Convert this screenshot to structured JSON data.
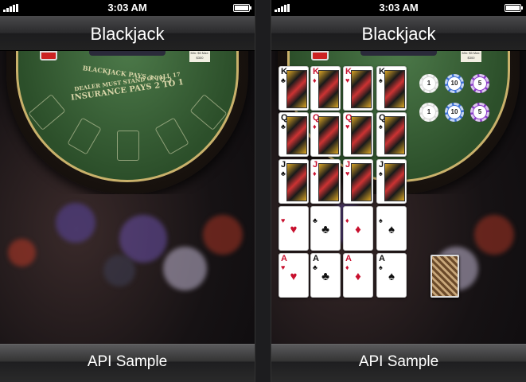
{
  "status": {
    "time": "3:03 AM"
  },
  "screens": [
    {
      "title": "Blackjack",
      "footer": "API Sample"
    },
    {
      "title": "Blackjack",
      "footer": "API Sample"
    }
  ],
  "table": {
    "line1": "BLACKJACK PAYS 3 TO 2",
    "line2": "DEALER MUST STAND ON ALL 17",
    "line3": "INSURANCE PAYS 2 TO 1",
    "minmax": "Min: $5 Max: $300"
  },
  "cards": {
    "row1": [
      {
        "rank": "K",
        "suit": "♣",
        "color": "black"
      },
      {
        "rank": "K",
        "suit": "♦",
        "color": "red"
      },
      {
        "rank": "K",
        "suit": "♥",
        "color": "red"
      },
      {
        "rank": "K",
        "suit": "♠",
        "color": "black"
      }
    ],
    "row2": [
      {
        "rank": "Q",
        "suit": "♣",
        "color": "black"
      },
      {
        "rank": "Q",
        "suit": "♦",
        "color": "red"
      },
      {
        "rank": "Q",
        "suit": "♥",
        "color": "red"
      },
      {
        "rank": "Q",
        "suit": "♠",
        "color": "black"
      }
    ],
    "row3": [
      {
        "rank": "J",
        "suit": "♣",
        "color": "black"
      },
      {
        "rank": "J",
        "suit": "♦",
        "color": "red"
      },
      {
        "rank": "J",
        "suit": "♥",
        "color": "red"
      },
      {
        "rank": "J",
        "suit": "♠",
        "color": "black"
      }
    ],
    "row4": [
      {
        "rank": "",
        "suit": "♥",
        "color": "red"
      },
      {
        "rank": "",
        "suit": "♣",
        "color": "black"
      },
      {
        "rank": "",
        "suit": "♦",
        "color": "red"
      },
      {
        "rank": "",
        "suit": "♠",
        "color": "black"
      }
    ],
    "row5": [
      {
        "rank": "A",
        "suit": "♥",
        "color": "red"
      },
      {
        "rank": "A",
        "suit": "♣",
        "color": "black"
      },
      {
        "rank": "A",
        "suit": "♦",
        "color": "red"
      },
      {
        "rank": "A",
        "suit": "♠",
        "color": "black"
      }
    ]
  },
  "chips": [
    {
      "value": "1",
      "color": "#d9d9d9"
    },
    {
      "value": "10",
      "color": "#3b6fd6"
    },
    {
      "value": "5",
      "color": "#8b3cc9"
    },
    {
      "value": "1",
      "color": "#d9d9d9"
    },
    {
      "value": "10",
      "color": "#3b6fd6"
    },
    {
      "value": "5",
      "color": "#8b3cc9"
    }
  ]
}
